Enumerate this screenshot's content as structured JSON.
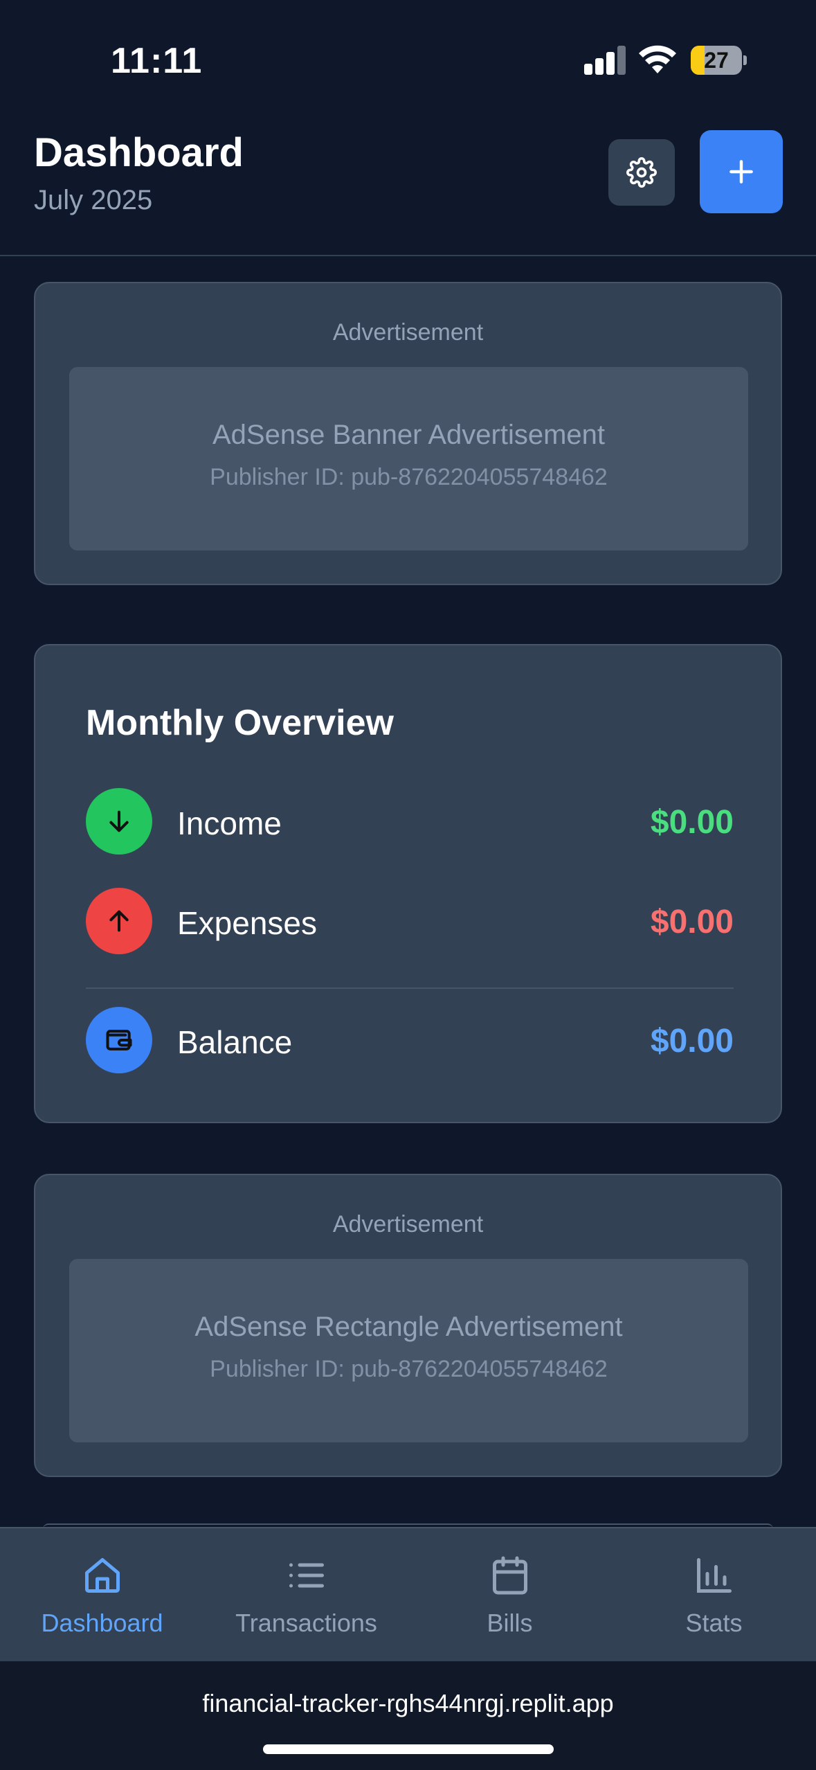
{
  "status_bar": {
    "time": "11:11",
    "battery": "27",
    "battery_level": 0.27
  },
  "header": {
    "title": "Dashboard",
    "subtitle": "July 2025"
  },
  "ads": [
    {
      "label": "Advertisement",
      "title": "AdSense Banner Advertisement",
      "publisher": "Publisher ID: pub-8762204055748462"
    },
    {
      "label": "Advertisement",
      "title": "AdSense Rectangle Advertisement",
      "publisher": "Publisher ID: pub-8762204055748462"
    }
  ],
  "overview": {
    "title": "Monthly Overview",
    "income": {
      "label": "Income",
      "amount": "$0.00",
      "color": "#4ade80",
      "icon": "arrow-down-icon"
    },
    "expenses": {
      "label": "Expenses",
      "amount": "$0.00",
      "color": "#f87171",
      "icon": "arrow-up-icon"
    },
    "balance": {
      "label": "Balance",
      "amount": "$0.00",
      "color": "#60a5fa",
      "icon": "wallet-icon"
    }
  },
  "nav": {
    "items": [
      {
        "label": "Dashboard",
        "icon": "home-icon",
        "active": true
      },
      {
        "label": "Transactions",
        "icon": "list-icon",
        "active": false
      },
      {
        "label": "Bills",
        "icon": "calendar-icon",
        "active": false
      },
      {
        "label": "Stats",
        "icon": "bar-chart-icon",
        "active": false
      }
    ]
  },
  "browser": {
    "url": "financial-tracker-rghs44nrgj.replit.app"
  },
  "colors": {
    "background": "#0f172a",
    "card": "#334155",
    "accent": "#3b82f6",
    "income": "#22c55e",
    "expense": "#ef4444"
  }
}
